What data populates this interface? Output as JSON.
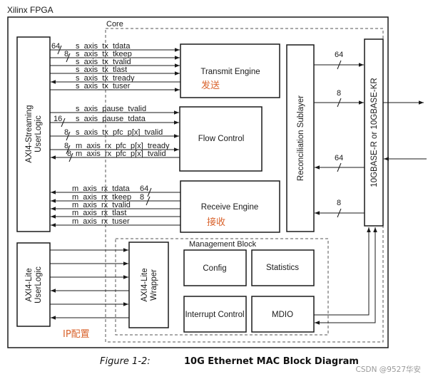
{
  "title": "Xilinx FPGA",
  "core_label": "Core",
  "blocks": {
    "axi4_stream_userlogic": "AXI4-Streaming UserLogic",
    "axi4_stream_userlogic_line1": "AXI4-Streaming",
    "axi4_stream_userlogic_line2": "UserLogic",
    "transmit_engine": "Transmit Engine",
    "transmit_engine_cn": "发送",
    "flow_control": "Flow Control",
    "receive_engine": "Receive Engine",
    "receive_engine_cn": "接收",
    "reconciliation_sublayer": "Reconciliation Sublayer",
    "phy": "10GBASE-R or 10GBASE-KR",
    "axi4_lite_userlogic_line1": "AXI4-Lite",
    "axi4_lite_userlogic_line2": "UserLogic",
    "axi4_lite_wrapper_line1": "AXI4-Lite",
    "axi4_lite_wrapper_line2": "Wrapper",
    "management_block": "Management Block",
    "config": "Config",
    "statistics": "Statistics",
    "interrupt_control": "Interrupt Control",
    "mdio": "MDIO",
    "ip_config_cn": "IP配置"
  },
  "tx_signals": [
    {
      "name": "s_axis_tx_tdata",
      "dir": "in",
      "width": "64"
    },
    {
      "name": "s_axis_tx_tkeep",
      "dir": "in",
      "width": "8"
    },
    {
      "name": "s_axis_tx_tvalid",
      "dir": "in",
      "width": ""
    },
    {
      "name": "s_axis_tx_tlast",
      "dir": "in",
      "width": ""
    },
    {
      "name": "s_axis_tx_tready",
      "dir": "out",
      "width": ""
    },
    {
      "name": "s_axis_tx_tuser",
      "dir": "in",
      "width": ""
    }
  ],
  "fc_signals": [
    {
      "name": "s_axis_pause_tvalid",
      "dir": "in",
      "width": ""
    },
    {
      "name": "s_axis_pause_tdata",
      "dir": "in",
      "width": "16"
    },
    {
      "name": "s_axis_tx_pfc_p[x]_tvalid",
      "dir": "in",
      "width": "8"
    },
    {
      "name": "m_axis_rx_pfc_p[x]_tready",
      "dir": "in",
      "width": "8"
    },
    {
      "name": "m_axis_rx_pfc_p[x]_tvalid",
      "dir": "out",
      "width": "8"
    }
  ],
  "rx_signals": [
    {
      "name": "m_axis_rx_tdata",
      "dir": "out",
      "width": "64"
    },
    {
      "name": "m_axis_rx_tkeep",
      "dir": "out",
      "width": "8"
    },
    {
      "name": "m_axis_rx_tvalid",
      "dir": "out",
      "width": ""
    },
    {
      "name": "m_axis_rx_tlast",
      "dir": "out",
      "width": ""
    },
    {
      "name": "m_axis_rx_tuser",
      "dir": "out",
      "width": ""
    }
  ],
  "rs_phy_buses": {
    "tx_data_width": "64",
    "tx_ctrl_width": "8",
    "rx_data_width": "64",
    "rx_ctrl_width": "8"
  },
  "axi_lite_lines": [
    "in",
    "in",
    "in",
    "out",
    "in",
    "out"
  ],
  "caption": {
    "figure": "Figure 1-2:",
    "title": "10G Ethernet MAC Block Diagram"
  },
  "watermark": "CSDN @9527华安",
  "colors": {
    "line": "#1a1a1a",
    "dashed": "#555555",
    "annotation": "#d9622b"
  }
}
